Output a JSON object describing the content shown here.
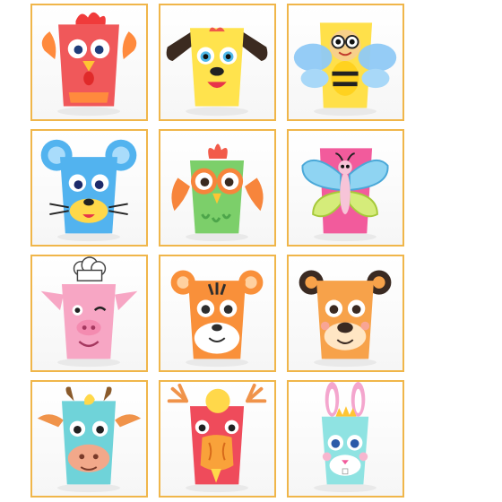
{
  "gallery": {
    "tiles": [
      {
        "name": "rooster-cup-tile",
        "icon": "rooster-icon",
        "cup_color": "#f0585a",
        "accent": "#ff8a3d"
      },
      {
        "name": "dog-cup-tile",
        "icon": "dog-icon",
        "cup_color": "#ffe34d",
        "accent": "#3b2a20"
      },
      {
        "name": "bee-cup-tile",
        "icon": "bee-icon",
        "cup_color": "#ffe04a",
        "accent": "#8fc9f5"
      },
      {
        "name": "mouse-cup-tile",
        "icon": "mouse-icon",
        "cup_color": "#52b3ef",
        "accent": "#ffd84a"
      },
      {
        "name": "owl-cup-tile",
        "icon": "owl-icon",
        "cup_color": "#7ccf6a",
        "accent": "#f7853c"
      },
      {
        "name": "butterfly-cup-tile",
        "icon": "butterfly-icon",
        "cup_color": "#f25b9c",
        "accent": "#8fd4f2"
      },
      {
        "name": "pig-cup-tile",
        "icon": "pig-icon",
        "cup_color": "#f7a6c4",
        "accent": "#ffffff"
      },
      {
        "name": "tiger-cup-tile",
        "icon": "tiger-icon",
        "cup_color": "#f9903a",
        "accent": "#2e2e2e"
      },
      {
        "name": "bear-cup-tile",
        "icon": "bear-icon",
        "cup_color": "#f7a24a",
        "accent": "#3a2a22"
      },
      {
        "name": "cow-cup-tile",
        "icon": "cow-icon",
        "cup_color": "#6fd3d9",
        "accent": "#f0934a"
      },
      {
        "name": "dragon-cup-tile",
        "icon": "dragon-icon",
        "cup_color": "#ef4b5b",
        "accent": "#ffd84a"
      },
      {
        "name": "rabbit-cup-tile",
        "icon": "rabbit-icon",
        "cup_color": "#8fe3e2",
        "accent": "#f4a6ce"
      }
    ]
  }
}
